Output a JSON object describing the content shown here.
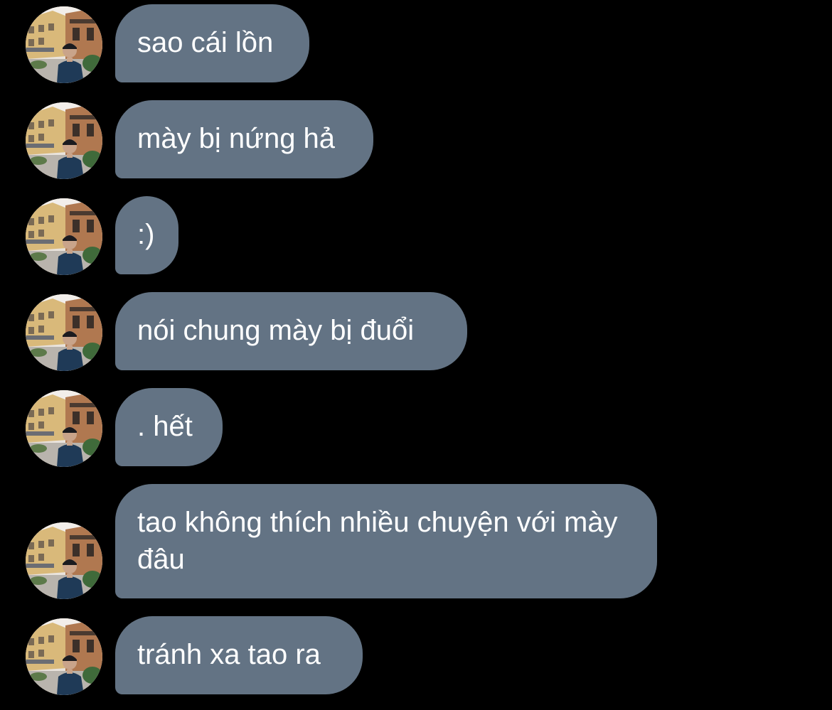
{
  "colors": {
    "background": "#000000",
    "bubble": "#637384",
    "text": "#ffffff"
  },
  "messages": [
    {
      "text": "sao cái lồn",
      "avatar_icon": "profile-photo-avatar"
    },
    {
      "text": "mày bị nứng hả",
      "avatar_icon": "profile-photo-avatar"
    },
    {
      "text": ":)",
      "avatar_icon": "profile-photo-avatar"
    },
    {
      "text": "nói chung mày bị đuổi",
      "avatar_icon": "profile-photo-avatar"
    },
    {
      "text": ". hết",
      "avatar_icon": "profile-photo-avatar"
    },
    {
      "text": "tao không thích nhiều chuyện với mày đâu",
      "avatar_icon": "profile-photo-avatar"
    },
    {
      "text": "tránh xa tao ra",
      "avatar_icon": "profile-photo-avatar"
    }
  ]
}
